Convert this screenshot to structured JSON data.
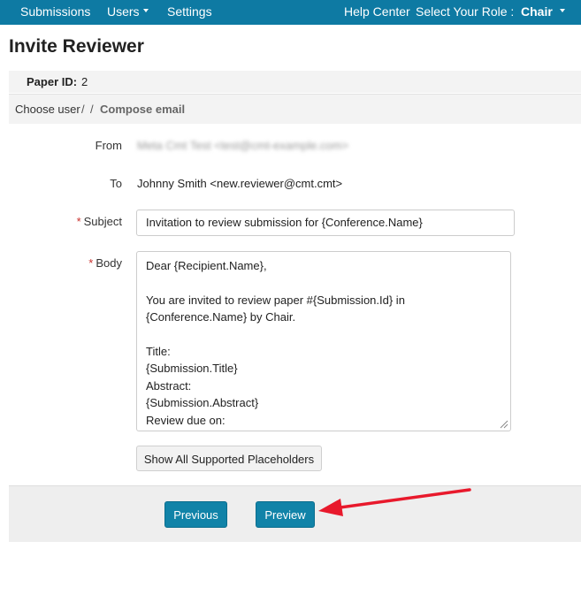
{
  "nav": {
    "submissions": "Submissions",
    "users": "Users",
    "settings": "Settings",
    "help_center": "Help Center",
    "role_label": "Select Your Role :",
    "role_value": "Chair"
  },
  "page": {
    "title": "Invite Reviewer",
    "paper_id_label": "Paper ID:",
    "paper_id_value": "2"
  },
  "breadcrumb": {
    "choose_user": "Choose user",
    "sep1": "/",
    "sep2": "/",
    "current": "Compose email"
  },
  "form": {
    "from_label": "From",
    "from_value": "Meta Cmt Test <test@cmt-example.com>",
    "to_label": "To",
    "to_value": "Johnny Smith <new.reviewer@cmt.cmt>",
    "required_marker": "*",
    "subject_label": "Subject",
    "subject_value": "Invitation to review submission for {Conference.Name}",
    "body_label": "Body",
    "body_value": "Dear {Recipient.Name},\n\nYou are invited to review paper #{Submission.Id} in {Conference.Name} by Chair.\n\nTitle:\n{Submission.Title}\nAbstract:\n{Submission.Abstract}\nReview due on:\n{Review.DueDate}"
  },
  "buttons": {
    "placeholders": "Show All Supported Placeholders",
    "previous": "Previous",
    "preview": "Preview"
  },
  "colors": {
    "nav_bg": "#0e7aa3",
    "primary_button": "#1183a8",
    "annotation_arrow": "#e8192c",
    "required": "#c9302c"
  },
  "icons": {
    "dropdown": "caret-down-icon",
    "resize": "resize-grip-icon",
    "annotation": "red-arrow"
  }
}
